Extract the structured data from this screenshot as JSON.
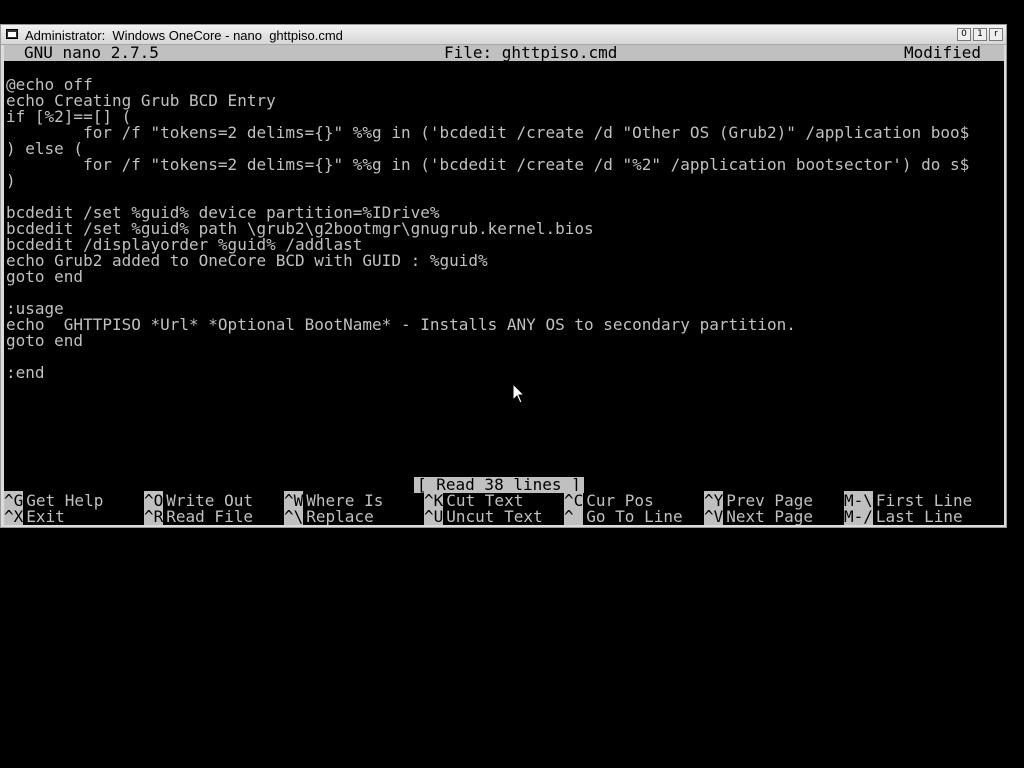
{
  "window": {
    "title": "Administrator:  Windows OneCore - nano  ghttpiso.cmd",
    "buttons": [
      "0",
      "1",
      "r"
    ]
  },
  "nano": {
    "version": "GNU nano 2.7.5",
    "file": "File: ghttpiso.cmd",
    "state": "Modified"
  },
  "editor_lines": [
    "@echo off",
    "echo Creating Grub BCD Entry",
    "if [%2]==[] (",
    "        for /f \"tokens=2 delims={}\" %%g in ('bcdedit /create /d \"Other OS (Grub2)\" /application boo$",
    ") else (",
    "        for /f \"tokens=2 delims={}\" %%g in ('bcdedit /create /d \"%2\" /application bootsector') do s$",
    ")",
    "",
    "bcdedit /set %guid% device partition=%IDrive%",
    "bcdedit /set %guid% path \\grub2\\g2bootmgr\\gnugrub.kernel.bios",
    "bcdedit /displayorder %guid% /addlast",
    "echo Grub2 added to OneCore BCD with GUID : %guid%",
    "goto end",
    "",
    ":usage",
    "echo  GHTTPISO *Url* *Optional BootName* - Installs ANY OS to secondary partition.",
    "goto end",
    "",
    ":end"
  ],
  "status_message": "[ Read 38 lines ]",
  "shortcuts": {
    "row1": [
      {
        "key": "^G",
        "label": "Get Help"
      },
      {
        "key": "^O",
        "label": "Write Out"
      },
      {
        "key": "^W",
        "label": "Where Is"
      },
      {
        "key": "^K",
        "label": "Cut Text"
      },
      {
        "key": "^C",
        "label": "Cur Pos"
      },
      {
        "key": "^Y",
        "label": "Prev Page"
      },
      {
        "key": "M-\\",
        "label": "First Line"
      }
    ],
    "row2": [
      {
        "key": "^X",
        "label": "Exit"
      },
      {
        "key": "^R",
        "label": "Read File"
      },
      {
        "key": "^\\",
        "label": "Replace"
      },
      {
        "key": "^U",
        "label": "Uncut Text"
      },
      {
        "key": "^_",
        "label": "Go To Line"
      },
      {
        "key": "^V",
        "label": "Next Page"
      },
      {
        "key": "M-/",
        "label": "Last Line"
      }
    ]
  },
  "colors": {
    "terminal_bg": "#000000",
    "terminal_fg": "#c0c0c0",
    "inverse_bg": "#c0c0c0"
  }
}
